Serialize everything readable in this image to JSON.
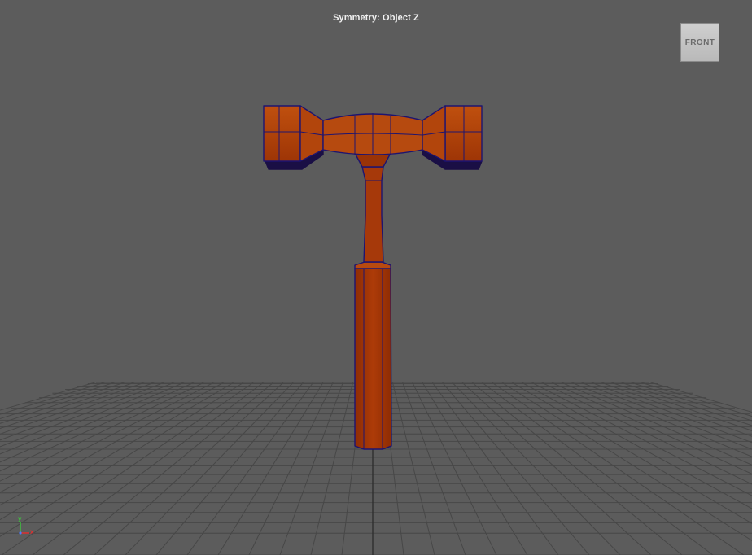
{
  "viewport": {
    "hud_title": "Symmetry: Object Z",
    "view_cube_label": "FRONT",
    "model": "hammer-mesh"
  },
  "axis": {
    "y_label": "y",
    "x_label": "x"
  },
  "colors": {
    "background": "#5c5c5c",
    "grid": "#474747",
    "mesh_fill": "#a63a0a",
    "mesh_wire": "#1e1470"
  }
}
